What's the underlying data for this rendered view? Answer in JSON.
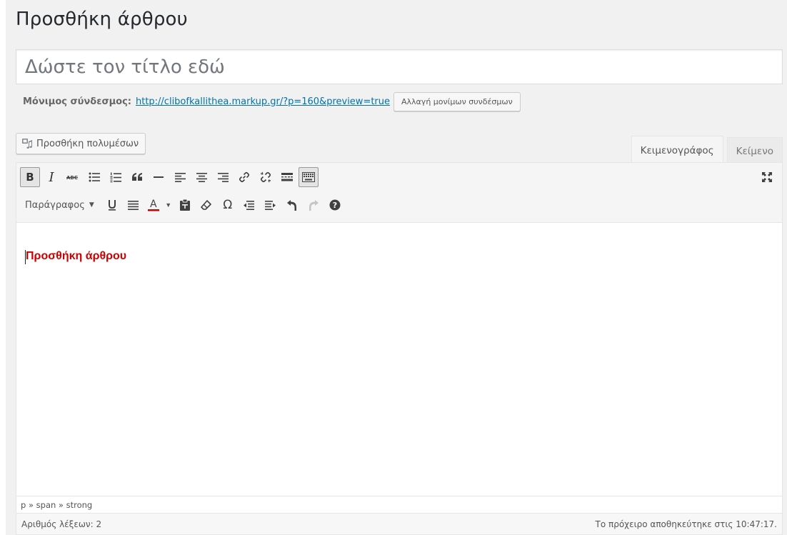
{
  "page": {
    "title": "Προσθήκη άρθρου"
  },
  "post_title": {
    "placeholder": "Δώστε τον τίτλο εδώ"
  },
  "permalink": {
    "label": "Μόνιμος σύνδεσμος:",
    "url": "http://clibofkallithea.markup.gr/?p=160&preview=true",
    "change_button": "Αλλαγή μονίμων συνδέσμων"
  },
  "media": {
    "add_button": "Προσθήκη πολυμέσων",
    "icon": "media-icon"
  },
  "tabs": [
    {
      "label": "Κειμενογράφος",
      "active": true
    },
    {
      "label": "Κείμενο",
      "active": false
    }
  ],
  "toolbar": {
    "row1": [
      "bold-icon",
      "italic-icon",
      "strikethrough-icon",
      "bullet-list-icon",
      "numbered-list-icon",
      "blockquote-icon",
      "horizontal-rule-icon",
      "align-left-icon",
      "align-center-icon",
      "align-right-icon",
      "link-icon",
      "unlink-icon",
      "read-more-icon",
      "toolbar-toggle-icon"
    ],
    "row2": [
      "underline-icon",
      "justify-icon",
      "text-color-icon",
      "paste-text-icon",
      "clear-formatting-icon",
      "special-character-icon",
      "outdent-icon",
      "indent-icon",
      "undo-icon",
      "redo-icon",
      "help-icon"
    ],
    "bold_label": "B",
    "italic_label": "I",
    "format_select": "Παράγραφος",
    "text_color": "#cc0000",
    "fullscreen_icon": "fullscreen-icon"
  },
  "content": {
    "text": "Προσθήκη άρθρου",
    "text_color": "#cc0000"
  },
  "path": "p » span » strong",
  "status": {
    "word_count": "Αριθμός λέξεων: 2",
    "saved": "Το πρόχειρο αποθηκεύτηκε στις 10:47:17."
  }
}
